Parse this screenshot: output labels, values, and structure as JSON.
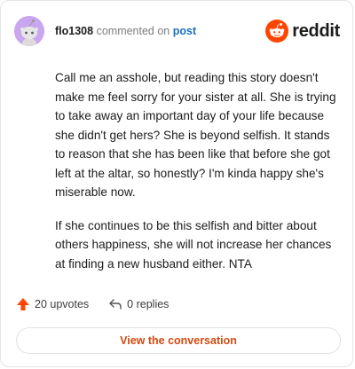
{
  "header": {
    "username": "flo1308",
    "action_text": "commented on",
    "post_link": "post",
    "brand": "reddit"
  },
  "comment": {
    "paragraphs": [
      "Call me an asshole, but reading this story doesn't make me feel sorry for your sister at all. She is trying to take away an important day of your life because she didn't get hers? She is beyond selfish. It stands to reason that she has been like that before she got left at the altar, so honestly? I'm kinda happy she's miserable now.",
      "If she continues to be this selfish and bitter about others happiness, she will not increase her chances at finding a new husband either. NTA"
    ]
  },
  "stats": {
    "upvotes": "20 upvotes",
    "replies": "0 replies"
  },
  "cta": {
    "label": "View the conversation"
  },
  "colors": {
    "accent": "#ff4500",
    "link": "#1a6fc4",
    "cta_text": "#d04a11",
    "avatar_bg": "#c9a6ee"
  },
  "icons": [
    "snoo-avatar-icon",
    "reddit-logo-icon",
    "upvote-arrow-icon",
    "reply-arrow-icon"
  ]
}
